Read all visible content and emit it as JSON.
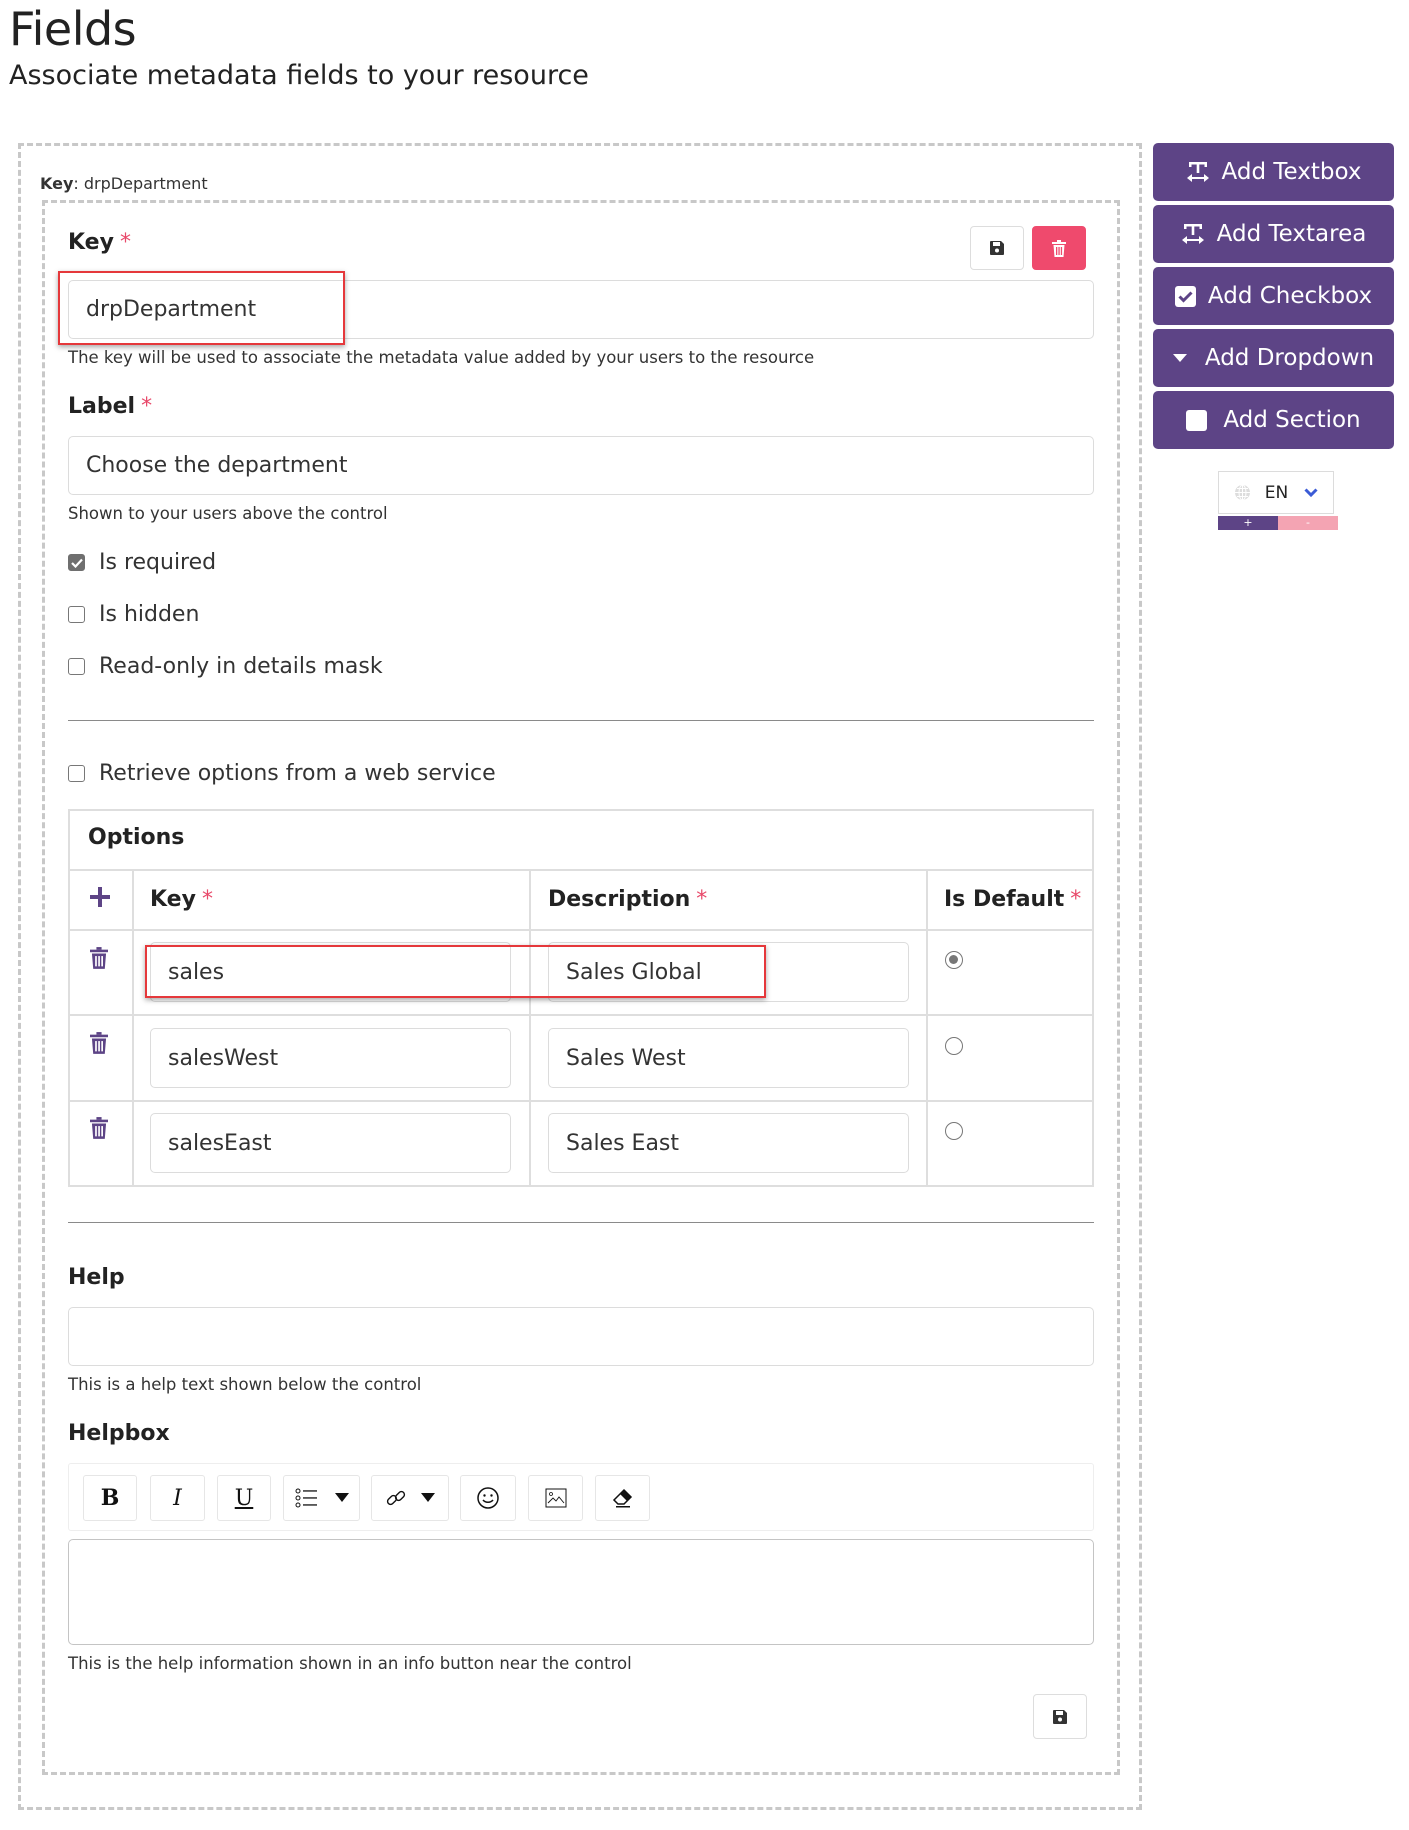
{
  "page": {
    "title": "Fields",
    "subtitle": "Associate metadata fields to your resource"
  },
  "field": {
    "caption_label": "Key",
    "caption_value": ": drpDepartment",
    "key": {
      "label": "Key",
      "required_mark": "*",
      "value": "drpDepartment",
      "hint": "The key will be used to associate the metadata value added by your users to the resource"
    },
    "label": {
      "label": "Label",
      "required_mark": "*",
      "value": "Choose the department",
      "hint": "Shown to your users above the control"
    },
    "checkboxes": [
      {
        "label": "Is required",
        "checked": true
      },
      {
        "label": "Is hidden",
        "checked": false
      },
      {
        "label": "Read-only in details mask",
        "checked": false
      }
    ],
    "web_service": {
      "label": "Retrieve options from a web service",
      "checked": false
    },
    "options": {
      "title": "Options",
      "columns": {
        "key": "Key",
        "description": "Description",
        "is_default": "Is Default",
        "required_mark": "*"
      },
      "rows": [
        {
          "key": "sales",
          "description": "Sales Global",
          "is_default": true
        },
        {
          "key": "salesWest",
          "description": "Sales West",
          "is_default": false
        },
        {
          "key": "salesEast",
          "description": "Sales East",
          "is_default": false
        }
      ]
    },
    "help": {
      "label": "Help",
      "value": "",
      "hint": "This is a help text shown below the control"
    },
    "helpbox": {
      "label": "Helpbox",
      "value": "",
      "hint": "This is the help information shown in an info button near the control",
      "toolbar": [
        "bold",
        "italic",
        "underline",
        "list",
        "link",
        "emoji",
        "image",
        "clear-format"
      ],
      "bold_glyph": "B",
      "italic_glyph": "I",
      "underline_glyph": "U"
    }
  },
  "sidebar": {
    "buttons": [
      {
        "label": "Add Textbox",
        "icon": "text-width-icon"
      },
      {
        "label": "Add Textarea",
        "icon": "text-width-icon"
      },
      {
        "label": "Add Checkbox",
        "icon": "checkbox-icon"
      },
      {
        "label": "Add Dropdown",
        "icon": "caret-down-icon"
      },
      {
        "label": "Add Section",
        "icon": "square-icon"
      }
    ],
    "language": {
      "current": "EN",
      "plus": "+",
      "minus": "-"
    }
  },
  "colors": {
    "primary": "#5d4486",
    "danger": "#ef4a6d",
    "required": "#e8496a",
    "highlight": "#e5383b"
  }
}
